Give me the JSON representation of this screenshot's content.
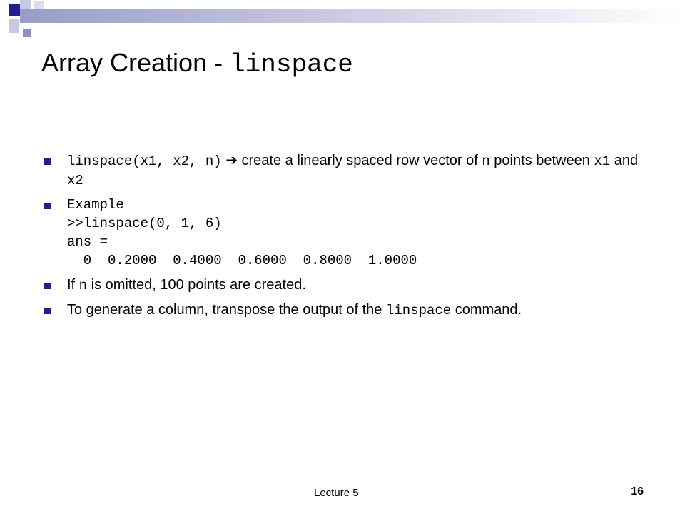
{
  "theme": {
    "accent_dark": "#1f1f8f",
    "accent_mid": "#6b6bb5",
    "accent_light": "#c7c8e4",
    "bar_start": "#9a9bc8",
    "bar_end": "#ffffff"
  },
  "slide": {
    "title_text": "Array Creation - ",
    "title_code": "linspace",
    "bullets": [
      {
        "segments": [
          {
            "text": "linspace(x1, x2, n)",
            "mono": true
          },
          {
            "text": " ➔ create a linearly spaced row vector of ",
            "mono": false
          },
          {
            "text": "n",
            "mono": true
          },
          {
            "text": " points between ",
            "mono": false
          },
          {
            "text": "x1",
            "mono": true
          },
          {
            "text": " and ",
            "mono": false
          },
          {
            "text": "x2",
            "mono": true
          }
        ]
      },
      {
        "code_lines": [
          "Example",
          ">>linspace(0, 1, 6)",
          "ans =",
          "  0  0.2000  0.4000  0.6000  0.8000  1.0000"
        ]
      },
      {
        "segments": [
          {
            "text": "If ",
            "mono": false
          },
          {
            "text": "n",
            "mono": true
          },
          {
            "text": " is omitted, 100 points are created.",
            "mono": false
          }
        ]
      },
      {
        "segments": [
          {
            "text": "To generate a column, transpose the output of the ",
            "mono": false
          },
          {
            "text": "linspace",
            "mono": true
          },
          {
            "text": " command.",
            "mono": false
          }
        ]
      }
    ]
  },
  "footer": {
    "label": "Lecture 5",
    "page_number": "16"
  }
}
